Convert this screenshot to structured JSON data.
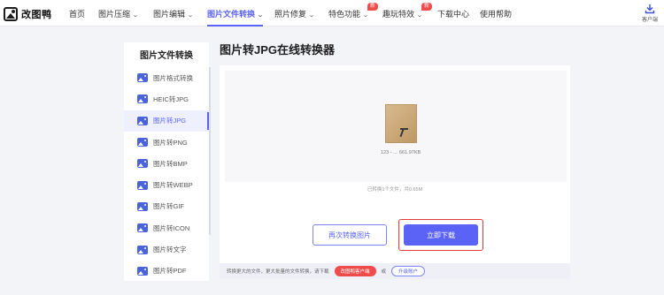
{
  "brand": {
    "name": "改图鸭"
  },
  "nav": {
    "items": [
      {
        "label": "首页",
        "has_chevron": false
      },
      {
        "label": "图片压缩",
        "has_chevron": true
      },
      {
        "label": "图片编辑",
        "has_chevron": true
      },
      {
        "label": "图片文件转换",
        "has_chevron": true,
        "active": true
      },
      {
        "label": "照片修复",
        "has_chevron": true
      },
      {
        "label": "特色功能",
        "has_chevron": true,
        "badge": "新"
      },
      {
        "label": "趣玩特效",
        "has_chevron": true,
        "badge": "新"
      },
      {
        "label": "下载中心",
        "has_chevron": false
      },
      {
        "label": "使用帮助",
        "has_chevron": false
      }
    ],
    "chevron": "⌄",
    "client_label": "客户端"
  },
  "sidebar": {
    "title": "图片文件转换",
    "items": [
      {
        "label": "图片格式转换"
      },
      {
        "label": "HEIC转JPG"
      },
      {
        "label": "图片转JPG",
        "active": true
      },
      {
        "label": "图片转PNG"
      },
      {
        "label": "图片转BMP"
      },
      {
        "label": "图片转WEBP"
      },
      {
        "label": "图片转GIF"
      },
      {
        "label": "图片转ICON"
      },
      {
        "label": "图片转文字"
      },
      {
        "label": "图片转PDF"
      }
    ]
  },
  "page": {
    "title": "图片转JPG在线转换器"
  },
  "result": {
    "file_name": "123 - ...",
    "file_size": "661.97KB",
    "summary": "已转换1个文件，共0.65M"
  },
  "actions": {
    "again_label": "再次转换图片",
    "download_label": "立即下载"
  },
  "footer": {
    "text": "转换更大的文件，更大批量的文件转换，请下载",
    "client_button": "改图鸭客户端",
    "or": "或",
    "upgrade_button": "升级账户"
  },
  "colors": {
    "accent": "#5b63f6",
    "highlight": "#e53935",
    "badge": "#f04b4b"
  }
}
